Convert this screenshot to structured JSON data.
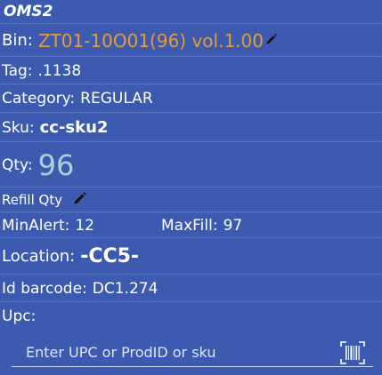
{
  "header": {
    "title": "OMS2"
  },
  "bin": {
    "label": "Bin:",
    "value": "ZT01-10O01(96) vol.1.00"
  },
  "tag": {
    "label": "Tag:",
    "value": ".1138"
  },
  "category": {
    "label": "Category:",
    "value": "REGULAR"
  },
  "sku": {
    "label": "Sku:",
    "value": "cc-sku2"
  },
  "qty": {
    "label": "Qty:",
    "value": "96"
  },
  "refill": {
    "label": "Refill Qty"
  },
  "min_alert": {
    "label": "MinAlert:",
    "value": "12"
  },
  "max_fill": {
    "label": "MaxFill:",
    "value": "97"
  },
  "location": {
    "label": "Location:",
    "value": "-CC5-"
  },
  "id_barcode": {
    "label": "Id barcode:",
    "value": "DC1.274"
  },
  "upc": {
    "label": "Upc:",
    "value": ""
  },
  "search": {
    "placeholder": "Enter UPC or ProdID or sku",
    "value": ""
  },
  "icons": {
    "edit": "pencil-icon",
    "scan": "barcode-scan-icon"
  },
  "colors": {
    "background": "#3c5bb0",
    "accent_orange": "#e69a38",
    "qty_teal": "#a8d2d6"
  }
}
